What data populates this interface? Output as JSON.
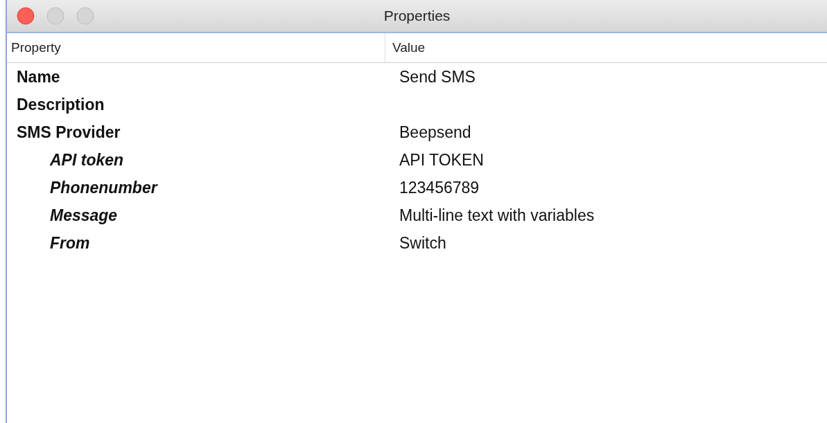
{
  "window": {
    "title": "Properties"
  },
  "table": {
    "columns": [
      "Property",
      "Value"
    ],
    "rows": [
      {
        "property": "Name",
        "value": "Send SMS"
      },
      {
        "property": "Description"
      },
      {
        "property": "SMS Provider",
        "value": "Beepsend",
        "children": [
          {
            "property": "API token",
            "value": "API TOKEN"
          },
          {
            "property": "Phonenumber",
            "value": "123456789"
          },
          {
            "property": "Message",
            "value": "Multi-line text with variables"
          },
          {
            "property": "From",
            "value": "Switch"
          }
        ]
      }
    ]
  }
}
